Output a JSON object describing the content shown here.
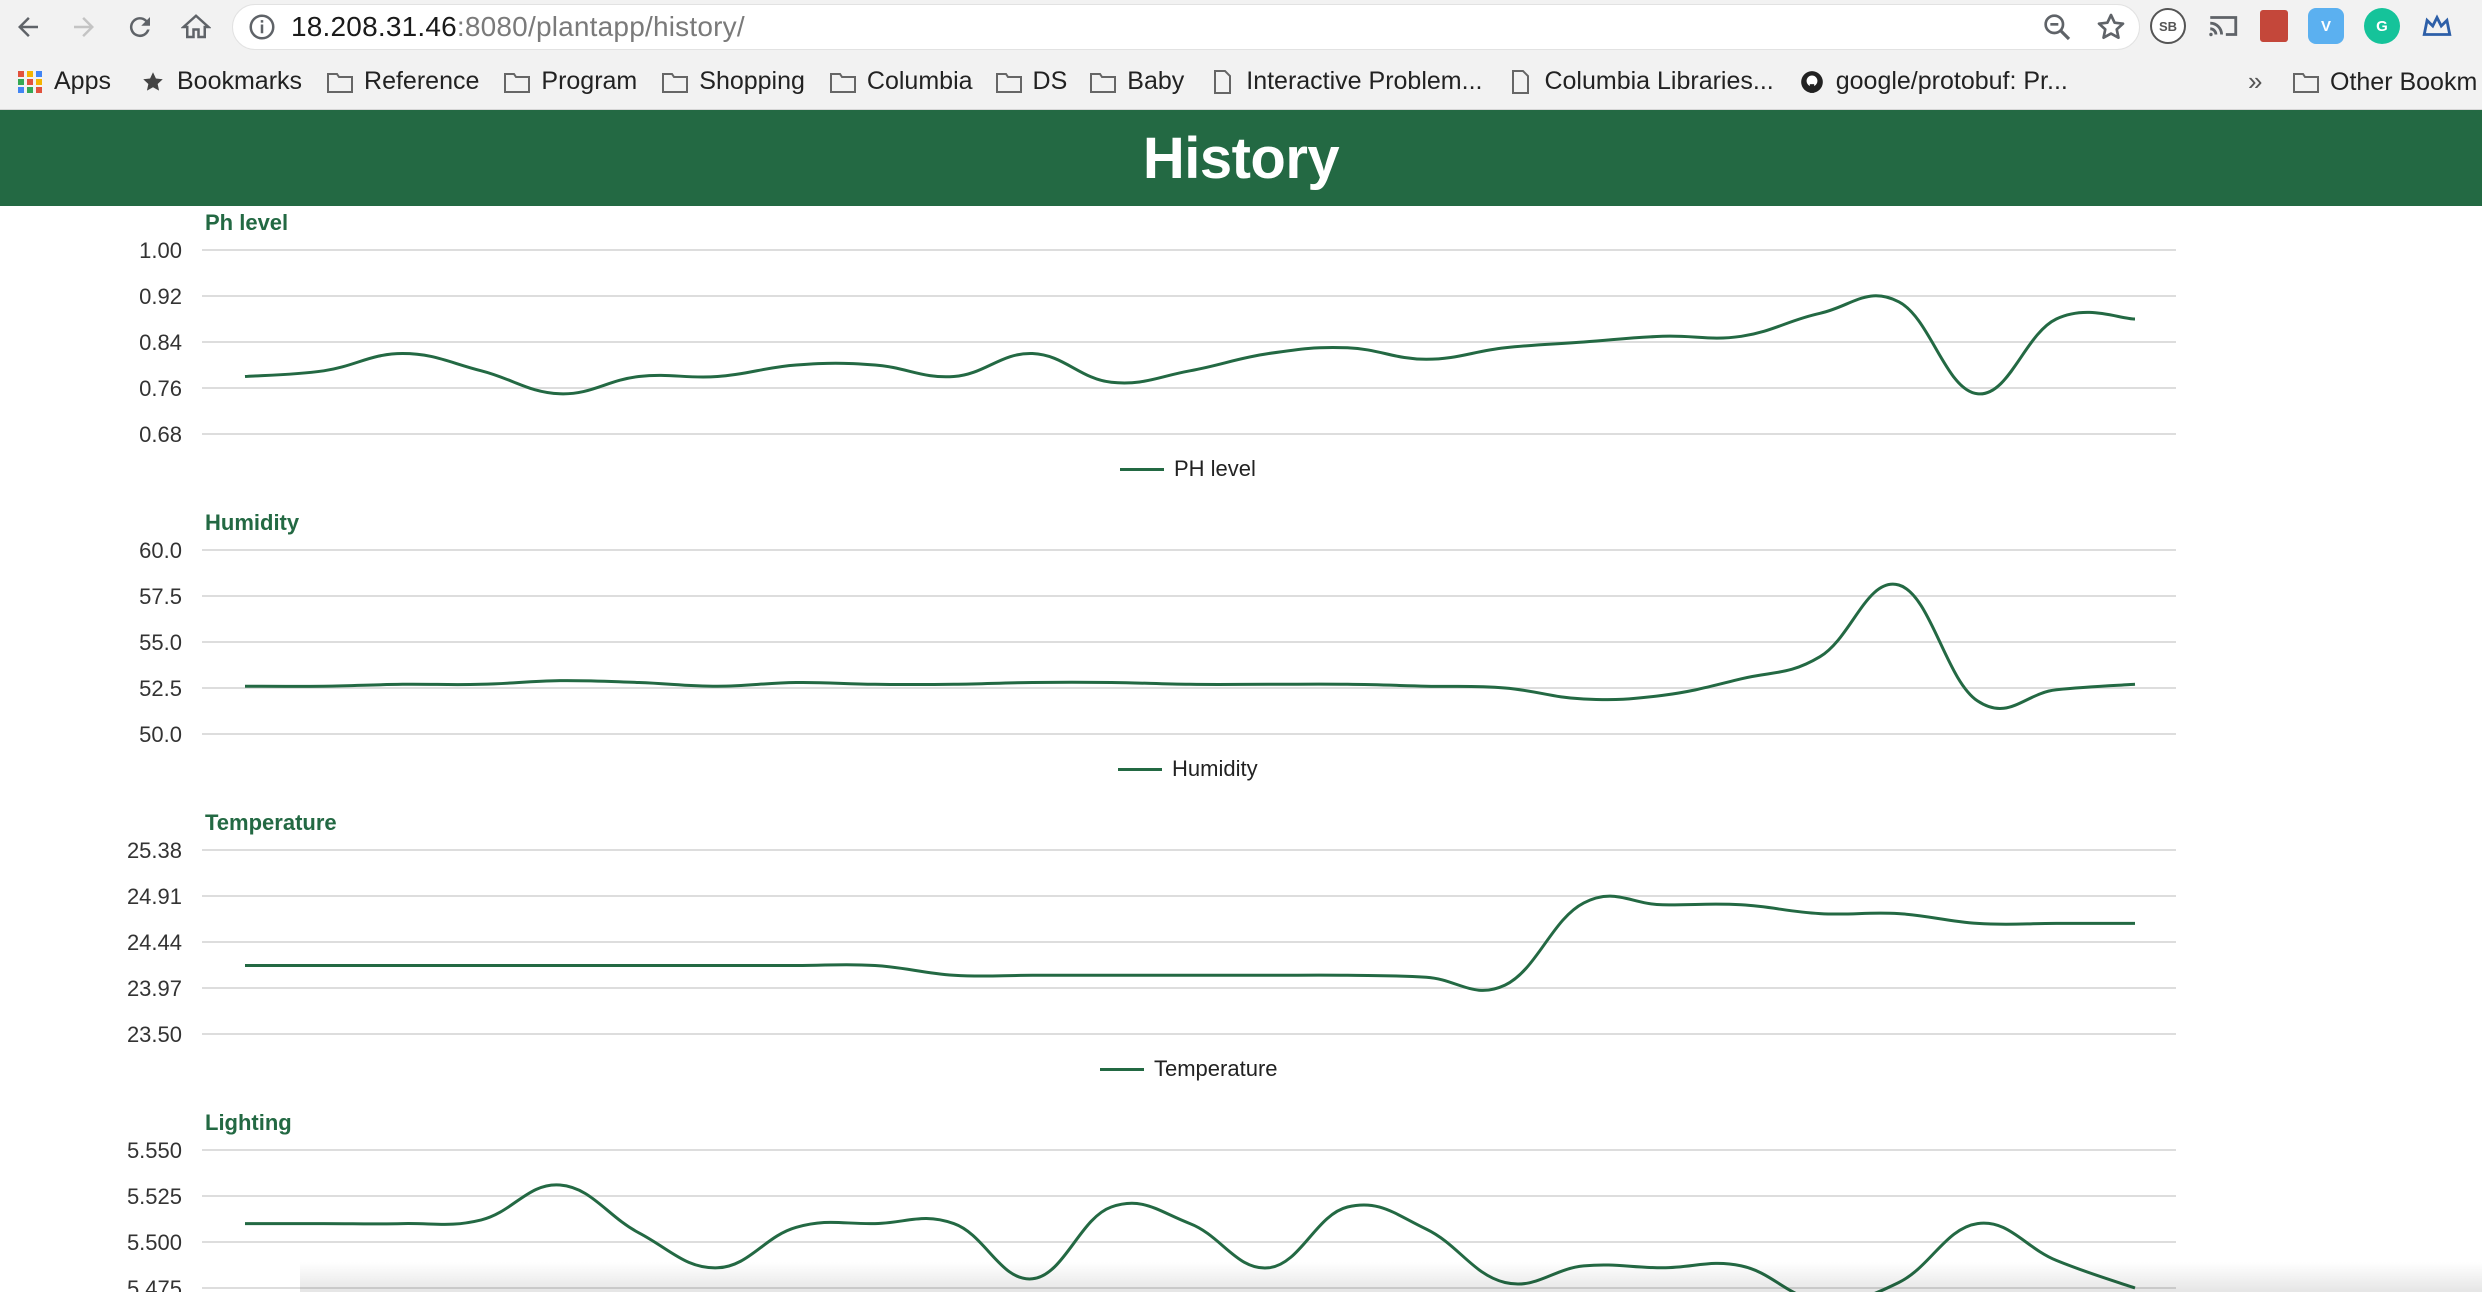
{
  "browser": {
    "url_host": "18.208.31.46",
    "url_path": ":8080/plantapp/history/"
  },
  "bookmarks": {
    "items": [
      {
        "label": "Apps",
        "icon": "apps-grid-icon"
      },
      {
        "label": "Bookmarks",
        "icon": "star-icon"
      },
      {
        "label": "Reference",
        "icon": "folder-icon"
      },
      {
        "label": "Program",
        "icon": "folder-icon"
      },
      {
        "label": "Shopping",
        "icon": "folder-icon"
      },
      {
        "label": "Columbia",
        "icon": "folder-icon"
      },
      {
        "label": "DS",
        "icon": "folder-icon"
      },
      {
        "label": "Baby",
        "icon": "folder-icon"
      },
      {
        "label": "Interactive Problem...",
        "icon": "page-icon"
      },
      {
        "label": "Columbia Libraries...",
        "icon": "page-icon"
      },
      {
        "label": "google/protobuf: Pr...",
        "icon": "github-icon"
      }
    ],
    "overflow": "»",
    "other_label": "Other Bookm"
  },
  "extensions": [
    "SB",
    "cast",
    "bookmark",
    "V",
    "G",
    "crown"
  ],
  "page": {
    "title": "History",
    "accent_color": "#236943"
  },
  "chart_data": [
    {
      "type": "line",
      "title": "Ph level",
      "series_name": "PH level",
      "yticks": [
        "1.00",
        "0.92",
        "0.84",
        "0.76",
        "0.68"
      ],
      "ylim": [
        0.68,
        1.0
      ],
      "values": [
        0.78,
        0.79,
        0.82,
        0.79,
        0.75,
        0.78,
        0.78,
        0.8,
        0.8,
        0.78,
        0.82,
        0.77,
        0.79,
        0.82,
        0.83,
        0.81,
        0.83,
        0.84,
        0.85,
        0.85,
        0.89,
        0.91,
        0.75,
        0.88,
        0.88
      ]
    },
    {
      "type": "line",
      "title": "Humidity",
      "series_name": "Humidity",
      "yticks": [
        "60.0",
        "57.5",
        "55.0",
        "52.5",
        "50.0"
      ],
      "ylim": [
        50.0,
        60.0
      ],
      "values": [
        52.6,
        52.6,
        52.7,
        52.7,
        52.9,
        52.8,
        52.6,
        52.8,
        52.7,
        52.7,
        52.8,
        52.8,
        52.7,
        52.7,
        52.7,
        52.6,
        52.5,
        51.9,
        52.1,
        53.0,
        54.2,
        58.1,
        51.8,
        52.4,
        52.7
      ]
    },
    {
      "type": "line",
      "title": "Temperature",
      "series_name": "Temperature",
      "yticks": [
        "25.38",
        "24.91",
        "24.44",
        "23.97",
        "23.50"
      ],
      "ylim": [
        23.5,
        25.38
      ],
      "values": [
        24.2,
        24.2,
        24.2,
        24.2,
        24.2,
        24.2,
        24.2,
        24.2,
        24.2,
        24.1,
        24.1,
        24.1,
        24.1,
        24.1,
        24.1,
        24.08,
        24.0,
        24.84,
        24.82,
        24.82,
        24.73,
        24.73,
        24.63,
        24.63,
        24.63
      ]
    },
    {
      "type": "line",
      "title": "Lighting",
      "series_name": "Lighting",
      "yticks": [
        "5.550",
        "5.525",
        "5.500",
        "5.475"
      ],
      "ylim": [
        5.475,
        5.55
      ],
      "values": [
        5.51,
        5.51,
        5.51,
        5.512,
        5.531,
        5.505,
        5.486,
        5.508,
        5.51,
        5.51,
        5.48,
        5.519,
        5.51,
        5.486,
        5.519,
        5.507,
        5.478,
        5.487,
        5.486,
        5.487,
        5.468,
        5.478,
        5.51,
        5.49,
        5.475
      ]
    }
  ]
}
